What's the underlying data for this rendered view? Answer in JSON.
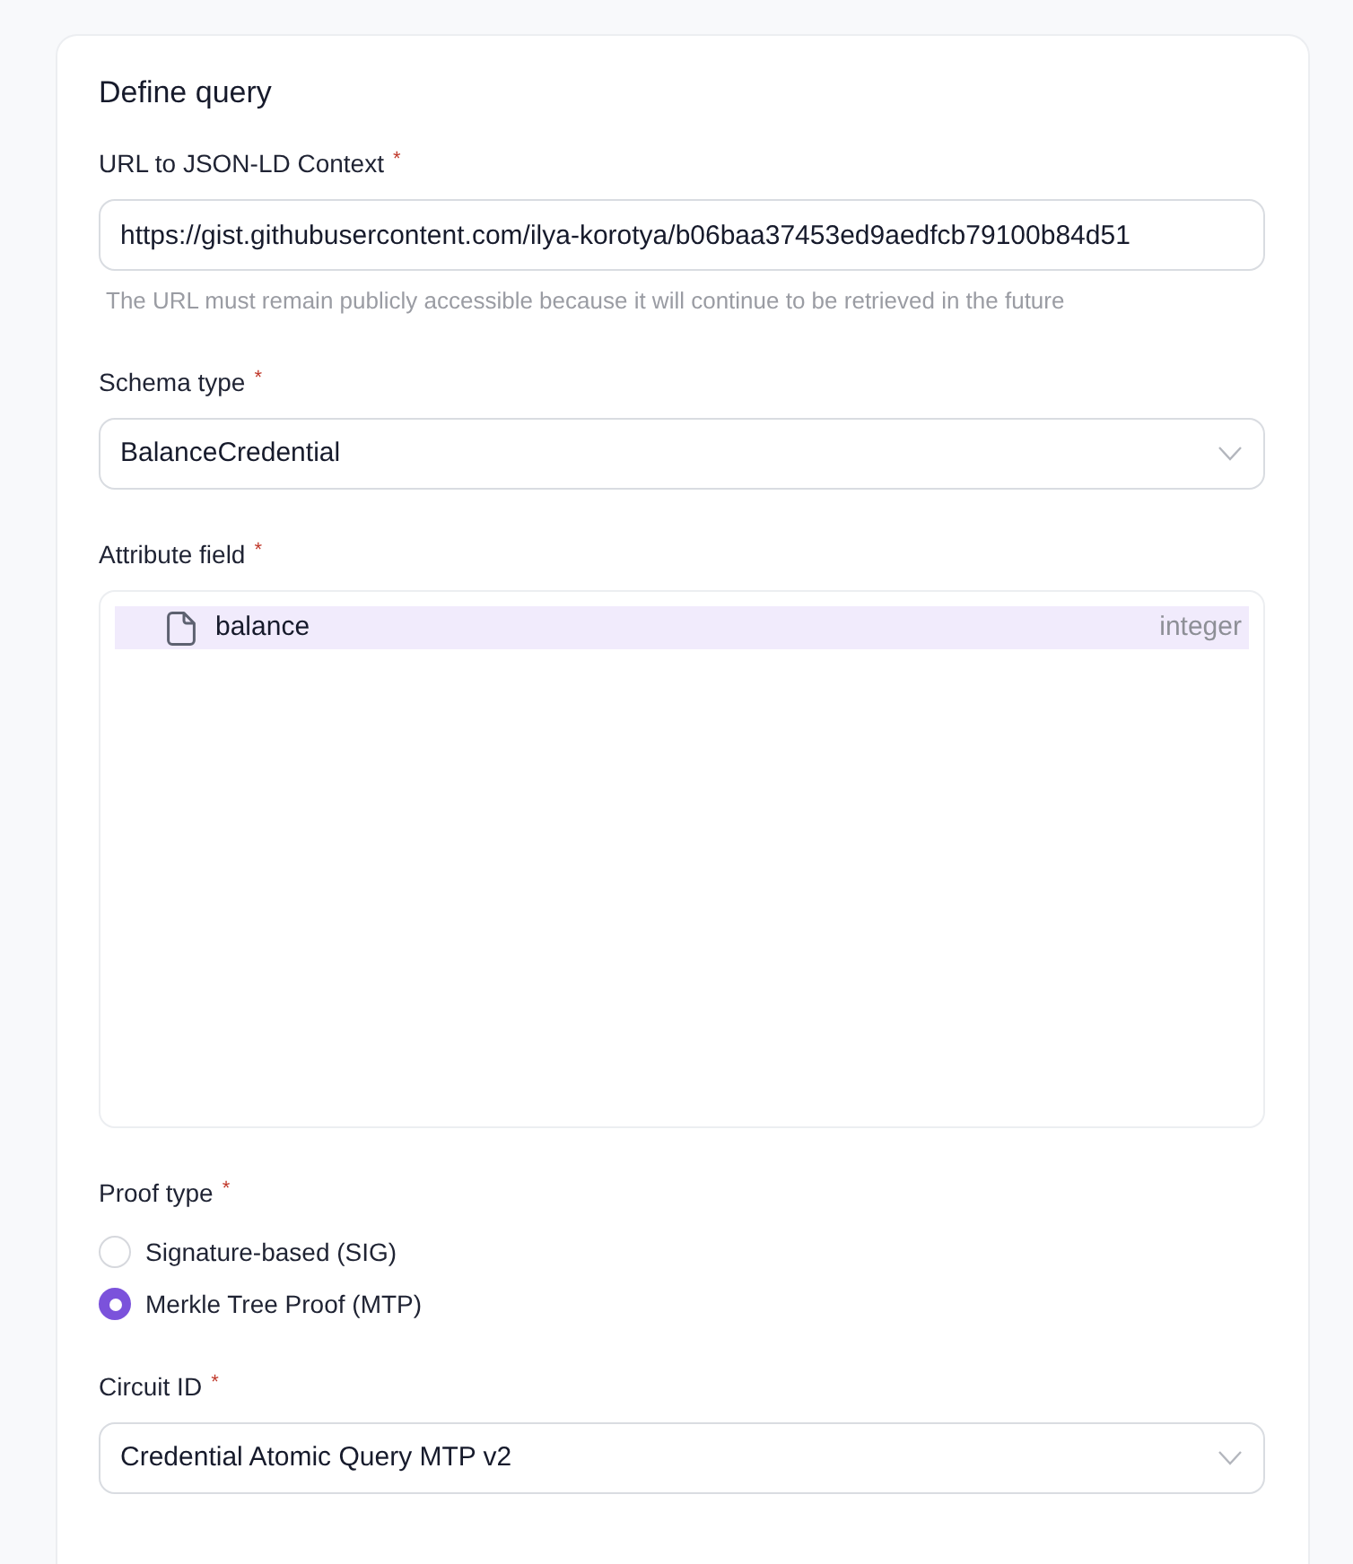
{
  "card": {
    "title": "Define query"
  },
  "fields": [
    {
      "kind": "text",
      "label": "URL to JSON-LD Context",
      "required_mark": "*",
      "value": "https://gist.githubusercontent.com/ilya-korotya/b06baa37453ed9aedfcb79100b84d51",
      "hint": "The URL must remain publicly accessible because it will continue to be retrieved in the future"
    },
    {
      "kind": "select",
      "label": "Schema type",
      "required_mark": "*",
      "value": "BalanceCredential"
    },
    {
      "kind": "tree",
      "label": "Attribute field",
      "required_mark": "*",
      "items": [
        {
          "name": "balance",
          "type": "integer",
          "selected": true
        }
      ]
    },
    {
      "kind": "radio",
      "label": "Proof type",
      "required_mark": "*",
      "options": [
        {
          "label": "Signature-based (SIG)",
          "selected": false
        },
        {
          "label": "Merkle Tree Proof (MTP)",
          "selected": true
        }
      ]
    },
    {
      "kind": "select",
      "label": "Circuit ID",
      "required_mark": "*",
      "value": "Credential Atomic Query MTP v2"
    }
  ]
}
